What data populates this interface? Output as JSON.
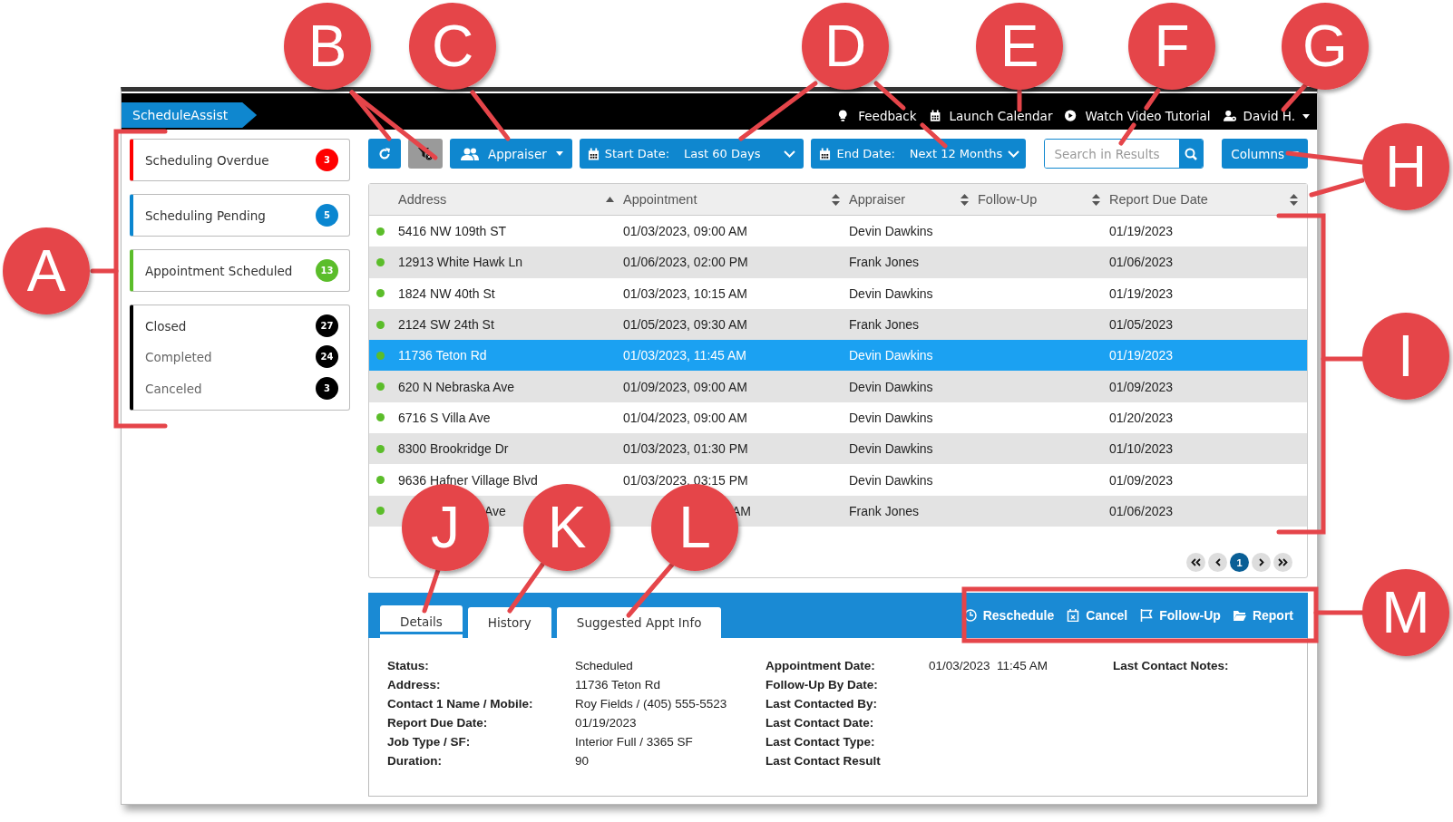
{
  "app": {
    "title": "ScheduleAssist"
  },
  "header_links": [
    {
      "kind": "feedback",
      "label": "Feedback"
    },
    {
      "kind": "calendar",
      "label": "Launch Calendar"
    },
    {
      "kind": "video",
      "label": "Watch Video Tutorial"
    },
    {
      "kind": "user",
      "label": "David H."
    }
  ],
  "sidebar": {
    "groups": [
      {
        "color": "#ff0000",
        "items": [
          {
            "kind": "header",
            "label": "Scheduling Overdue",
            "count": "3"
          }
        ]
      },
      {
        "color": "#0a86d0",
        "items": [
          {
            "kind": "header",
            "label": "Scheduling Pending",
            "count": "5"
          }
        ]
      },
      {
        "color": "#5bbd2a",
        "items": [
          {
            "kind": "header",
            "label": "Appointment Scheduled",
            "count": "13"
          }
        ]
      },
      {
        "color": "#000000",
        "items": [
          {
            "kind": "header",
            "label": "Closed",
            "count": "27"
          },
          {
            "kind": "sub",
            "label": "Completed",
            "count": "24"
          },
          {
            "kind": "sub",
            "label": "Canceled",
            "count": "3"
          }
        ]
      }
    ]
  },
  "toolbar": {
    "appraiser_button": {
      "label": "Appraiser"
    },
    "start_date": {
      "label": "Start Date:",
      "value": "Last 60 Days"
    },
    "end_date": {
      "label": "End Date:",
      "value": "Next 12 Months"
    },
    "search": {
      "placeholder": "Search in Results"
    },
    "columns_button": {
      "label": "Columns"
    }
  },
  "table": {
    "columns": [
      {
        "label": "Address",
        "sorted": true
      },
      {
        "label": "Appointment",
        "sorted": false
      },
      {
        "label": "Appraiser",
        "sorted": false
      },
      {
        "label": "Follow-Up",
        "sorted": false
      },
      {
        "label": "Report Due Date",
        "sorted": false
      }
    ],
    "rows": [
      {
        "kind": "plain",
        "address": "5416 NW 109th ST",
        "appointment": "01/03/2023, 09:00 AM",
        "appraiser": "Devin Dawkins",
        "report_due": "01/19/2023",
        "selected": false
      },
      {
        "kind": "plain",
        "address": "12913 White Hawk Ln",
        "appointment": "01/06/2023, 02:00 PM",
        "appraiser": "Frank Jones",
        "report_due": "01/06/2023",
        "selected": false
      },
      {
        "kind": "plain",
        "address": "1824 NW 40th St",
        "appointment": "01/03/2023, 10:15 AM",
        "appraiser": "Devin Dawkins",
        "report_due": "01/19/2023",
        "selected": false
      },
      {
        "kind": "plain",
        "address": "2124 SW 24th St",
        "appointment": "01/05/2023, 09:30 AM",
        "appraiser": "Frank Jones",
        "report_due": "01/05/2023",
        "selected": false
      },
      {
        "kind": "plain",
        "address": "11736 Teton Rd",
        "appointment": "01/03/2023, 11:45 AM",
        "appraiser": "Devin Dawkins",
        "report_due": "01/19/2023",
        "selected": true
      },
      {
        "kind": "plain",
        "address": "620 N Nebraska Ave",
        "appointment": "01/09/2023, 09:00 AM",
        "appraiser": "Devin Dawkins",
        "report_due": "01/09/2023",
        "selected": false
      },
      {
        "kind": "plain",
        "address": "6716 S Villa Ave",
        "appointment": "01/04/2023, 09:00 AM",
        "appraiser": "Devin Dawkins",
        "report_due": "01/20/2023",
        "selected": false
      },
      {
        "kind": "plain",
        "address": "8300 Brookridge Dr",
        "appointment": "01/03/2023, 01:30 PM",
        "appraiser": "Devin Dawkins",
        "report_due": "01/10/2023",
        "selected": false
      },
      {
        "kind": "plain",
        "address": "9636 Hafner Village Blvd",
        "appointment": "01/03/2023, 03:15 PM",
        "appraiser": "Devin Dawkins",
        "report_due": "01/09/2023",
        "selected": false
      },
      {
        "kind": "obscured",
        "address": "Ave",
        "appointment": "AM",
        "appraiser": "Frank Jones",
        "report_due": "01/06/2023",
        "selected": false
      }
    ]
  },
  "pager": {
    "pages": [
      {
        "label": "1",
        "selected": true
      }
    ]
  },
  "detail_tabs": [
    {
      "label": "Details",
      "selected": true
    },
    {
      "label": "History",
      "selected": false
    },
    {
      "label": "Suggested Appt Info",
      "selected": false
    }
  ],
  "actions": [
    {
      "kind": "clock",
      "label": "Reschedule"
    },
    {
      "kind": "calendar-x",
      "label": "Cancel"
    },
    {
      "kind": "flag",
      "label": "Follow-Up"
    },
    {
      "kind": "folder",
      "label": "Report"
    }
  ],
  "details": {
    "columns": [
      [
        {
          "label": "Status:",
          "value": "Scheduled"
        },
        {
          "label": "Address:",
          "value": "11736 Teton Rd"
        },
        {
          "label": "Contact 1 Name / Mobile:",
          "value": "Roy Fields / (405) 555-5523"
        },
        {
          "label": "Report Due Date:",
          "value": "01/19/2023"
        },
        {
          "label": "Job Type / SF:",
          "value": "Interior Full / 3365 SF"
        },
        {
          "label": "Duration:",
          "value": "90"
        }
      ],
      [
        {
          "label": "Appointment Date:",
          "value": "01/03/2023  11:45 AM"
        },
        {
          "label": "Follow-Up By Date:"
        },
        {
          "label": "Last Contacted By:"
        },
        {
          "label": "Last Contact Date:"
        },
        {
          "label": "Last Contact Type:"
        },
        {
          "label": "Last Contact Result"
        }
      ],
      [
        {
          "label": "Last Contact Notes:"
        }
      ]
    ]
  },
  "callouts": [
    {
      "letter": "A"
    },
    {
      "letter": "B"
    },
    {
      "letter": "C"
    },
    {
      "letter": "D"
    },
    {
      "letter": "E"
    },
    {
      "letter": "F"
    },
    {
      "letter": "G"
    },
    {
      "letter": "H"
    },
    {
      "letter": "I"
    },
    {
      "letter": "J"
    },
    {
      "letter": "K"
    },
    {
      "letter": "L"
    },
    {
      "letter": "M"
    }
  ]
}
